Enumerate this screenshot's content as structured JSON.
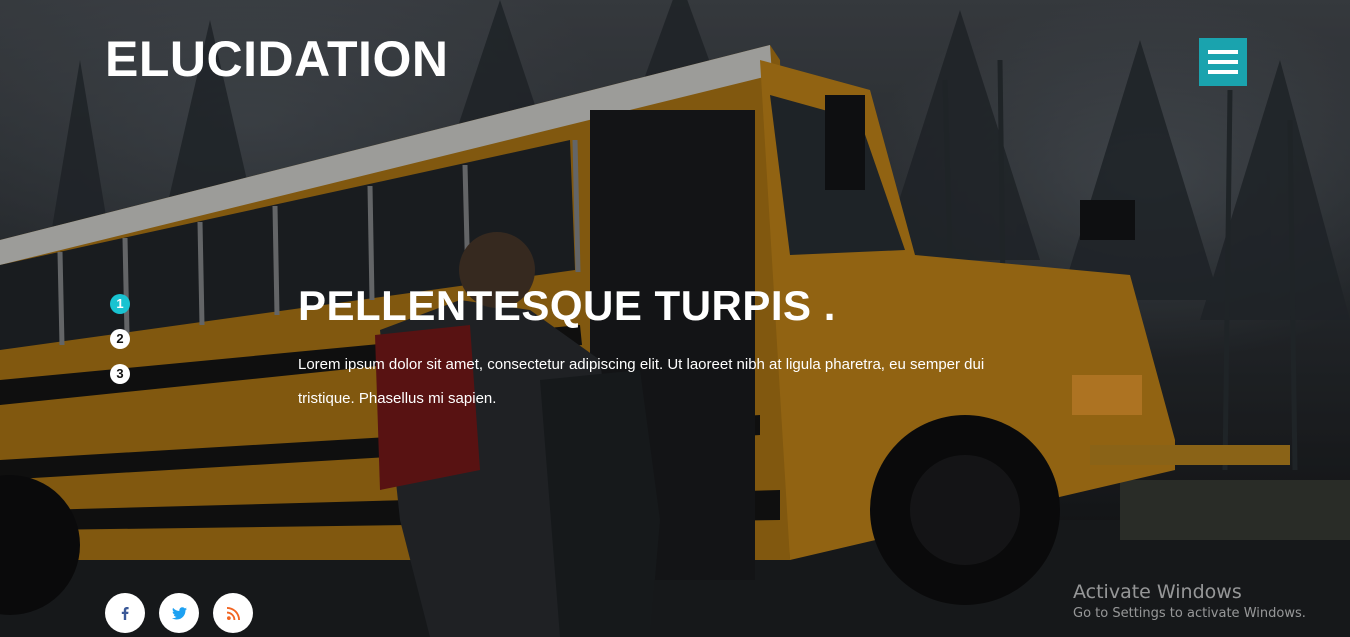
{
  "header": {
    "brand": "ELUCIDATION",
    "menu_icon": "hamburger-icon",
    "menu_color": "#1aa3ae"
  },
  "slider": {
    "dots": [
      {
        "label": "1",
        "active": true
      },
      {
        "label": "2",
        "active": false
      },
      {
        "label": "3",
        "active": false
      }
    ],
    "active_color": "#19c3d1",
    "title": "PELLENTESQUE TURPIS .",
    "text": "Lorem ipsum dolor sit amet, consectetur adipiscing elit. Ut laoreet nibh at ligula pharetra, eu semper dui tristique. Phasellus mi sapien."
  },
  "social": [
    {
      "icon": "facebook-icon",
      "color": "#3b5998"
    },
    {
      "icon": "twitter-icon",
      "color": "#1da1f2"
    },
    {
      "icon": "rss-icon",
      "color": "#f26522"
    }
  ],
  "activation_notice": {
    "title": "Activate Windows",
    "subtitle": "Go to Settings to activate Windows."
  }
}
